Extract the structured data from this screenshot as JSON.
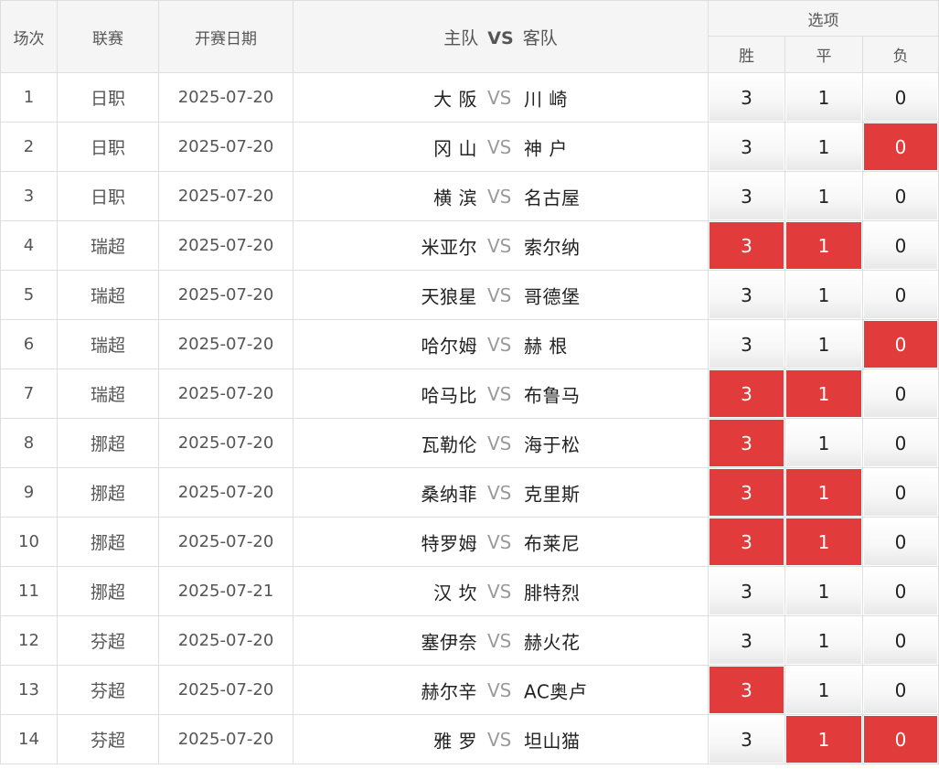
{
  "header": {
    "col_index": "场次",
    "col_league": "联赛",
    "col_date": "开赛日期",
    "col_home": "主队",
    "col_vs": "VS",
    "col_away": "客队",
    "col_options": "选项",
    "opt_win": "胜",
    "opt_draw": "平",
    "opt_lose": "负"
  },
  "colors": {
    "selected": "#e23b3b",
    "header_bg": "#f5f5f5",
    "border": "#dedede"
  },
  "rows": [
    {
      "index": "1",
      "league": "日职",
      "date": "2025-07-20",
      "home": "大 阪",
      "vs": "VS",
      "away": "川 崎",
      "win": "3",
      "draw": "1",
      "lose": "0",
      "win_selected": false,
      "draw_selected": false,
      "lose_selected": false
    },
    {
      "index": "2",
      "league": "日职",
      "date": "2025-07-20",
      "home": "冈 山",
      "vs": "VS",
      "away": "神 户",
      "win": "3",
      "draw": "1",
      "lose": "0",
      "win_selected": false,
      "draw_selected": false,
      "lose_selected": true
    },
    {
      "index": "3",
      "league": "日职",
      "date": "2025-07-20",
      "home": "横 滨",
      "vs": "VS",
      "away": "名古屋",
      "win": "3",
      "draw": "1",
      "lose": "0",
      "win_selected": false,
      "draw_selected": false,
      "lose_selected": false
    },
    {
      "index": "4",
      "league": "瑞超",
      "date": "2025-07-20",
      "home": "米亚尔",
      "vs": "VS",
      "away": "索尔纳",
      "win": "3",
      "draw": "1",
      "lose": "0",
      "win_selected": true,
      "draw_selected": true,
      "lose_selected": false
    },
    {
      "index": "5",
      "league": "瑞超",
      "date": "2025-07-20",
      "home": "天狼星",
      "vs": "VS",
      "away": "哥德堡",
      "win": "3",
      "draw": "1",
      "lose": "0",
      "win_selected": false,
      "draw_selected": false,
      "lose_selected": false
    },
    {
      "index": "6",
      "league": "瑞超",
      "date": "2025-07-20",
      "home": "哈尔姆",
      "vs": "VS",
      "away": "赫 根",
      "win": "3",
      "draw": "1",
      "lose": "0",
      "win_selected": false,
      "draw_selected": false,
      "lose_selected": true
    },
    {
      "index": "7",
      "league": "瑞超",
      "date": "2025-07-20",
      "home": "哈马比",
      "vs": "VS",
      "away": "布鲁马",
      "win": "3",
      "draw": "1",
      "lose": "0",
      "win_selected": true,
      "draw_selected": true,
      "lose_selected": false
    },
    {
      "index": "8",
      "league": "挪超",
      "date": "2025-07-20",
      "home": "瓦勒伦",
      "vs": "VS",
      "away": "海于松",
      "win": "3",
      "draw": "1",
      "lose": "0",
      "win_selected": true,
      "draw_selected": false,
      "lose_selected": false
    },
    {
      "index": "9",
      "league": "挪超",
      "date": "2025-07-20",
      "home": "桑纳菲",
      "vs": "VS",
      "away": "克里斯",
      "win": "3",
      "draw": "1",
      "lose": "0",
      "win_selected": true,
      "draw_selected": true,
      "lose_selected": false
    },
    {
      "index": "10",
      "league": "挪超",
      "date": "2025-07-20",
      "home": "特罗姆",
      "vs": "VS",
      "away": "布莱尼",
      "win": "3",
      "draw": "1",
      "lose": "0",
      "win_selected": true,
      "draw_selected": true,
      "lose_selected": false
    },
    {
      "index": "11",
      "league": "挪超",
      "date": "2025-07-21",
      "home": "汉 坎",
      "vs": "VS",
      "away": "腓特烈",
      "win": "3",
      "draw": "1",
      "lose": "0",
      "win_selected": false,
      "draw_selected": false,
      "lose_selected": false
    },
    {
      "index": "12",
      "league": "芬超",
      "date": "2025-07-20",
      "home": "塞伊奈",
      "vs": "VS",
      "away": "赫火花",
      "win": "3",
      "draw": "1",
      "lose": "0",
      "win_selected": false,
      "draw_selected": false,
      "lose_selected": false
    },
    {
      "index": "13",
      "league": "芬超",
      "date": "2025-07-20",
      "home": "赫尔辛",
      "vs": "VS",
      "away": "AC奥卢",
      "win": "3",
      "draw": "1",
      "lose": "0",
      "win_selected": true,
      "draw_selected": false,
      "lose_selected": false
    },
    {
      "index": "14",
      "league": "芬超",
      "date": "2025-07-20",
      "home": "雅 罗",
      "vs": "VS",
      "away": "坦山猫",
      "win": "3",
      "draw": "1",
      "lose": "0",
      "win_selected": false,
      "draw_selected": true,
      "lose_selected": true
    }
  ]
}
